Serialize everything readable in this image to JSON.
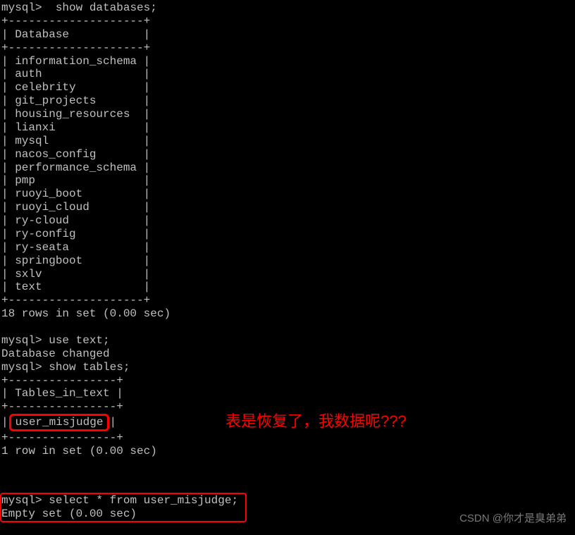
{
  "cmd1": {
    "prompt": "mysql> ",
    "input": " show databases;"
  },
  "db_table": {
    "top_border": "+--------------------+",
    "header_row": "| Database           |",
    "mid_border": "+--------------------+",
    "rows": [
      "| information_schema |",
      "| auth               |",
      "| celebrity          |",
      "| git_projects       |",
      "| housing_resources  |",
      "| lianxi             |",
      "| mysql              |",
      "| nacos_config       |",
      "| performance_schema |",
      "| pmp                |",
      "| ruoyi_boot         |",
      "| ruoyi_cloud        |",
      "| ry-cloud           |",
      "| ry-config          |",
      "| ry-seata           |",
      "| springboot         |",
      "| sxlv               |",
      "| text               |"
    ],
    "bot_border": "+--------------------+",
    "summary": "18 rows in set (0.00 sec)"
  },
  "cmd2": {
    "prompt": "mysql> ",
    "input": "use text;",
    "response": "Database changed"
  },
  "cmd3": {
    "prompt": "mysql> ",
    "input": "show tables;"
  },
  "tables_table": {
    "top_border": "+----------------+",
    "header_row": "| Tables_in_text |",
    "mid_border": "+----------------+",
    "row1_left": "|",
    "row1_value": "user_misjudge",
    "row1_right": "|",
    "bot_border": "+----------------+",
    "summary": "1 row in set (0.00 sec)"
  },
  "cmd4": {
    "prompt": "mysql> ",
    "input": "select * from user_misjudge;",
    "response": "Empty set (0.00 sec)"
  },
  "annotation": "表是恢复了，我数据呢???",
  "watermark": "CSDN @你才是臭弟弟"
}
